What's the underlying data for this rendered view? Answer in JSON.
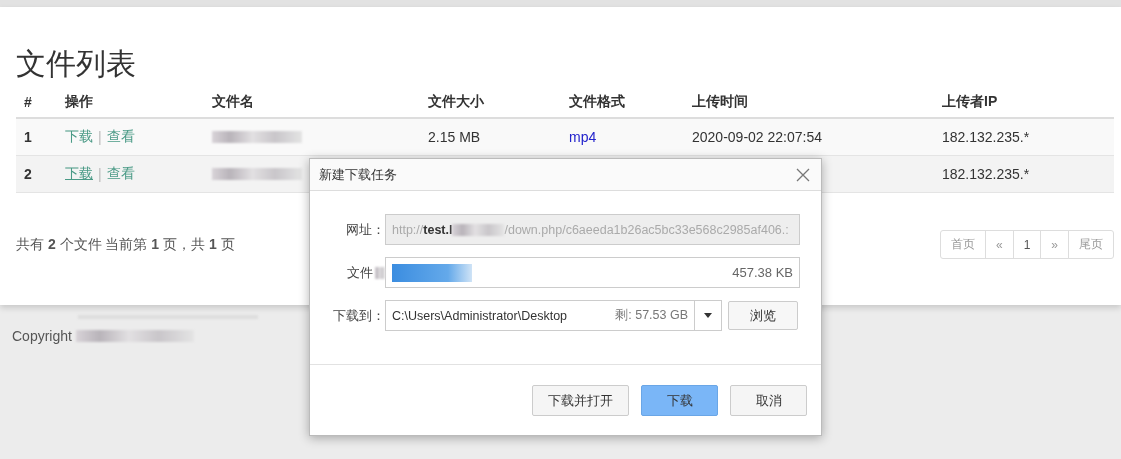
{
  "page": {
    "title": "文件列表"
  },
  "table": {
    "columns": [
      "#",
      "操作",
      "文件名",
      "文件大小",
      "文件格式",
      "上传时间",
      "上传者IP"
    ],
    "rows": [
      {
        "index": "1",
        "actions": [
          {
            "label": "下载",
            "hovered": false
          },
          {
            "label": "查看",
            "hovered": false
          }
        ],
        "separator": "|",
        "size": "2.15 MB",
        "format": "mp4",
        "time": "2020-09-02 22:07:54",
        "ip": "182.132.235.*"
      },
      {
        "index": "2",
        "actions": [
          {
            "label": "下载",
            "hovered": true
          },
          {
            "label": "查看",
            "hovered": false
          }
        ],
        "separator": "|",
        "ip": "182.132.235.*"
      }
    ]
  },
  "summary": "共有 **2** 个文件  当前第 **1** 页，共 **1** 页",
  "pagination": [
    {
      "label": "首页",
      "selected": false
    },
    {
      "label": "«",
      "selected": false
    },
    {
      "label": "1",
      "selected": true
    },
    {
      "label": "»",
      "selected": false
    },
    {
      "label": "尾页",
      "selected": false
    }
  ],
  "footer": {
    "text": "Copyright"
  },
  "dialog": {
    "title": "新建下载任务",
    "url_label": "网址：",
    "url_scheme": "http://",
    "url_host": "test.l",
    "url_path": "/down.php/c6aeeda1b26ac5bc33e568c2985af406.:",
    "file_label": "文件",
    "file_size": "457.38 KB",
    "save_label": "下载到：",
    "save_path": "C:\\Users\\Administrator\\Desktop",
    "free_space": "剩: 57.53 GB",
    "browse": "浏览",
    "buttons": [
      {
        "label": "下载并打开",
        "primary": false
      },
      {
        "label": "下载",
        "primary": true
      },
      {
        "label": "取消",
        "primary": false
      }
    ]
  }
}
